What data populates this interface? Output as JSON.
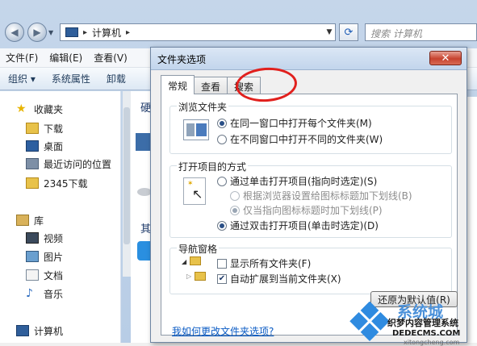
{
  "explorer": {
    "address": {
      "computer": "计算机"
    },
    "search_placeholder": "搜索 计算机",
    "menu": [
      "文件(F)",
      "编辑(E)",
      "查看(V)"
    ],
    "toolbar": [
      "组织 ▾",
      "系统属性",
      "卸载"
    ],
    "sidebar": {
      "favorites": "收藏夹",
      "items": [
        "下载",
        "桌面",
        "最近访问的位置",
        "2345下载"
      ],
      "library": "库",
      "lib_items": [
        "视频",
        "图片",
        "文档",
        "音乐"
      ],
      "computer": "计算机"
    },
    "content_frag": [
      "硬",
      "其"
    ]
  },
  "dialog": {
    "title": "文件夹选项",
    "tabs": [
      "常规",
      "查看",
      "搜索"
    ],
    "browse": {
      "title": "浏览文件夹",
      "opt1": "在同一窗口中打开每个文件夹(M)",
      "opt2": "在不同窗口中打开不同的文件夹(W)"
    },
    "open": {
      "title": "打开项目的方式",
      "opt1": "通过单击打开项目(指向时选定)(S)",
      "opt1a": "根据浏览器设置给图标标题加下划线(B)",
      "opt1b": "仅当指向图标标题时加下划线(P)",
      "opt2": "通过双击打开项目(单击时选定)(D)"
    },
    "nav": {
      "title": "导航窗格",
      "opt1": "显示所有文件夹(F)",
      "opt2": "自动扩展到当前文件夹(X)"
    },
    "restore_label": "还原为默认值(R)",
    "help_link": "我如何更改文件夹选项?"
  },
  "watermark": {
    "brand": "系统城",
    "line1": "织梦内容管理系统",
    "line2": "DEDECMS.COM",
    "url": "xitongcheng.com"
  },
  "colors": {
    "accent": "#2a4f86",
    "annotation": "#e1201d",
    "link": "#0a5bc4"
  }
}
